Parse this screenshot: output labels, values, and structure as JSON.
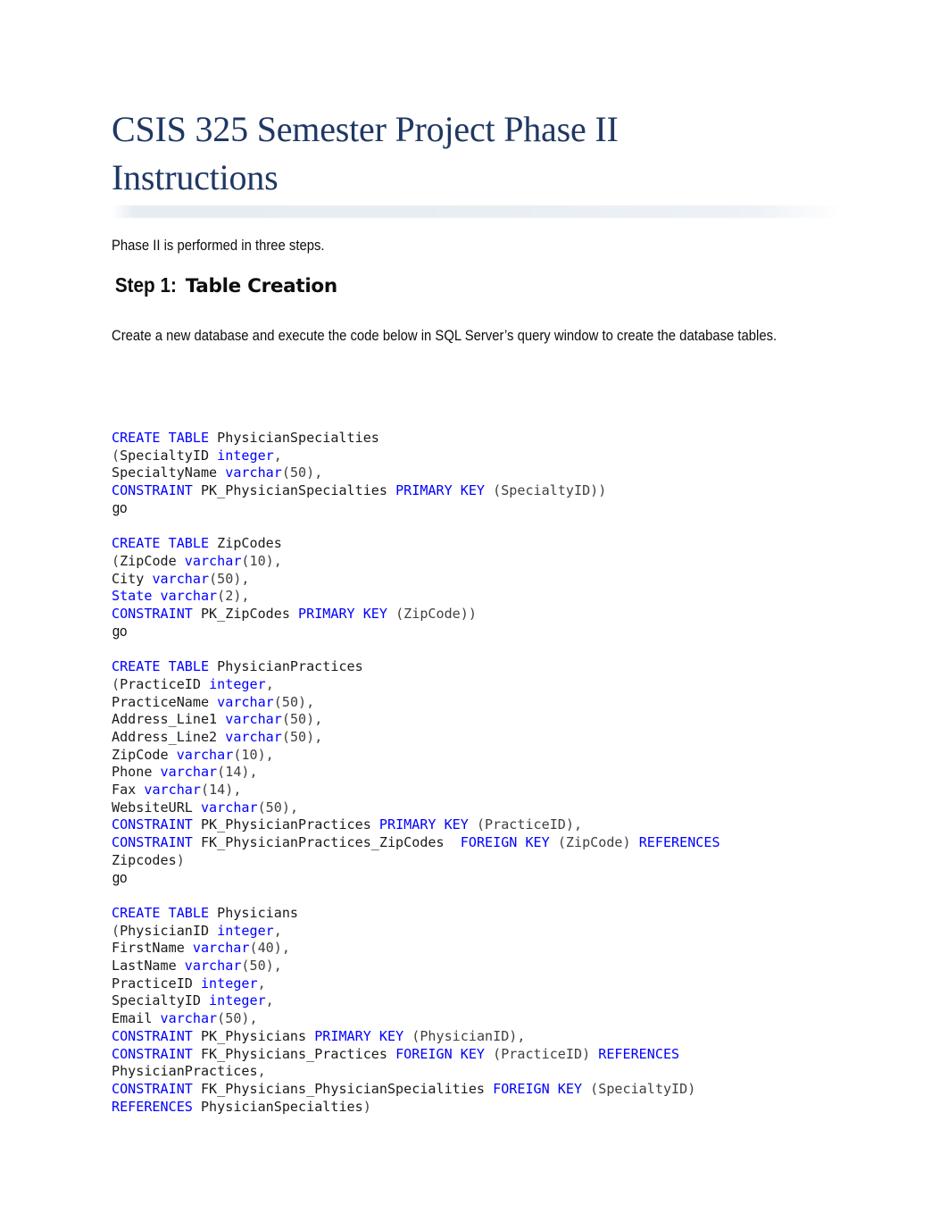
{
  "document": {
    "title": "CSIS 325 Semester Project Phase II Instructions",
    "intro_paragraph": "Phase II is performed in three steps.",
    "step": {
      "label": "Step 1:",
      "title": "Table Creation"
    },
    "step_paragraph": "Create a new database and execute the code below in SQL Server’s query window to create the database tables."
  },
  "colors": {
    "title": "#1F3864",
    "keyword": "#0000FF",
    "identifier": "#1A1A1A",
    "punctuation": "#404040",
    "body_text": "#0D0D0D",
    "rule": "#E9EEF2",
    "page_background": "#FFFFFF"
  },
  "code_blocks": [
    {
      "name": "create-table-physicianspecialties",
      "lines": [
        [
          {
            "t": "CREATE TABLE ",
            "c": "kw"
          },
          {
            "t": "PhysicianSpecialties",
            "c": "id"
          }
        ],
        [
          {
            "t": "(",
            "c": "pun"
          },
          {
            "t": "SpecialtyID ",
            "c": "id"
          },
          {
            "t": "integer",
            "c": "kw"
          },
          {
            "t": ",",
            "c": "pun"
          }
        ],
        [
          {
            "t": "SpecialtyName ",
            "c": "id"
          },
          {
            "t": "varchar",
            "c": "kw"
          },
          {
            "t": "(50),",
            "c": "pun"
          }
        ],
        [
          {
            "t": "CONSTRAINT ",
            "c": "kw"
          },
          {
            "t": "PK_PhysicianSpecialties ",
            "c": "id"
          },
          {
            "t": "PRIMARY KEY ",
            "c": "kw"
          },
          {
            "t": "(SpecialtyID))",
            "c": "pun"
          }
        ],
        [
          {
            "t": "go",
            "c": "go"
          }
        ]
      ]
    },
    {
      "name": "create-table-zipcodes",
      "lines": [
        [
          {
            "t": "CREATE TABLE ",
            "c": "kw"
          },
          {
            "t": "ZipCodes",
            "c": "id"
          }
        ],
        [
          {
            "t": "(",
            "c": "pun"
          },
          {
            "t": "ZipCode ",
            "c": "id"
          },
          {
            "t": "varchar",
            "c": "kw"
          },
          {
            "t": "(10),",
            "c": "pun"
          }
        ],
        [
          {
            "t": "City ",
            "c": "id"
          },
          {
            "t": "varchar",
            "c": "kw"
          },
          {
            "t": "(50),",
            "c": "pun"
          }
        ],
        [
          {
            "t": "State ",
            "c": "kw"
          },
          {
            "t": "varchar",
            "c": "kw"
          },
          {
            "t": "(2),",
            "c": "pun"
          }
        ],
        [
          {
            "t": "CONSTRAINT ",
            "c": "kw"
          },
          {
            "t": "PK_ZipCodes ",
            "c": "id"
          },
          {
            "t": "PRIMARY KEY ",
            "c": "kw"
          },
          {
            "t": "(ZipCode))",
            "c": "pun"
          }
        ],
        [
          {
            "t": "go",
            "c": "go"
          }
        ]
      ]
    },
    {
      "name": "create-table-physicianpractices",
      "lines": [
        [
          {
            "t": "CREATE TABLE ",
            "c": "kw"
          },
          {
            "t": "PhysicianPractices",
            "c": "id"
          }
        ],
        [
          {
            "t": "(",
            "c": "pun"
          },
          {
            "t": "PracticeID ",
            "c": "id"
          },
          {
            "t": "integer",
            "c": "kw"
          },
          {
            "t": ",",
            "c": "pun"
          }
        ],
        [
          {
            "t": "PracticeName ",
            "c": "id"
          },
          {
            "t": "varchar",
            "c": "kw"
          },
          {
            "t": "(50),",
            "c": "pun"
          }
        ],
        [
          {
            "t": "Address_Line1 ",
            "c": "id"
          },
          {
            "t": "varchar",
            "c": "kw"
          },
          {
            "t": "(50),",
            "c": "pun"
          }
        ],
        [
          {
            "t": "Address_Line2 ",
            "c": "id"
          },
          {
            "t": "varchar",
            "c": "kw"
          },
          {
            "t": "(50),",
            "c": "pun"
          }
        ],
        [
          {
            "t": "ZipCode ",
            "c": "id"
          },
          {
            "t": "varchar",
            "c": "kw"
          },
          {
            "t": "(10),",
            "c": "pun"
          }
        ],
        [
          {
            "t": "Phone ",
            "c": "id"
          },
          {
            "t": "varchar",
            "c": "kw"
          },
          {
            "t": "(14),",
            "c": "pun"
          }
        ],
        [
          {
            "t": "Fax ",
            "c": "id"
          },
          {
            "t": "varchar",
            "c": "kw"
          },
          {
            "t": "(14),",
            "c": "pun"
          }
        ],
        [
          {
            "t": "WebsiteURL ",
            "c": "id"
          },
          {
            "t": "varchar",
            "c": "kw"
          },
          {
            "t": "(50),",
            "c": "pun"
          }
        ],
        [
          {
            "t": "CONSTRAINT ",
            "c": "kw"
          },
          {
            "t": "PK_PhysicianPractices ",
            "c": "id"
          },
          {
            "t": "PRIMARY KEY ",
            "c": "kw"
          },
          {
            "t": "(PracticeID),",
            "c": "pun"
          }
        ],
        [
          {
            "t": "CONSTRAINT ",
            "c": "kw"
          },
          {
            "t": "FK_PhysicianPractices_ZipCodes  ",
            "c": "id"
          },
          {
            "t": "FOREIGN KEY ",
            "c": "kw"
          },
          {
            "t": "(ZipCode) ",
            "c": "pun"
          },
          {
            "t": "REFERENCES",
            "c": "kw"
          }
        ],
        [
          {
            "t": "Zipcodes",
            "c": "id"
          },
          {
            "t": ")",
            "c": "pun"
          }
        ],
        [
          {
            "t": "go",
            "c": "go"
          }
        ]
      ]
    },
    {
      "name": "create-table-physicians",
      "lines": [
        [
          {
            "t": "CREATE TABLE ",
            "c": "kw"
          },
          {
            "t": "Physicians",
            "c": "id"
          }
        ],
        [
          {
            "t": "(",
            "c": "pun"
          },
          {
            "t": "PhysicianID ",
            "c": "id"
          },
          {
            "t": "integer",
            "c": "kw"
          },
          {
            "t": ",",
            "c": "pun"
          }
        ],
        [
          {
            "t": "FirstName ",
            "c": "id"
          },
          {
            "t": "varchar",
            "c": "kw"
          },
          {
            "t": "(40),",
            "c": "pun"
          }
        ],
        [
          {
            "t": "LastName ",
            "c": "id"
          },
          {
            "t": "varchar",
            "c": "kw"
          },
          {
            "t": "(50),",
            "c": "pun"
          }
        ],
        [
          {
            "t": "PracticeID ",
            "c": "id"
          },
          {
            "t": "integer",
            "c": "kw"
          },
          {
            "t": ",",
            "c": "pun"
          }
        ],
        [
          {
            "t": "SpecialtyID ",
            "c": "id"
          },
          {
            "t": "integer",
            "c": "kw"
          },
          {
            "t": ",",
            "c": "pun"
          }
        ],
        [
          {
            "t": "Email ",
            "c": "id"
          },
          {
            "t": "varchar",
            "c": "kw"
          },
          {
            "t": "(50),",
            "c": "pun"
          }
        ],
        [
          {
            "t": "CONSTRAINT ",
            "c": "kw"
          },
          {
            "t": "PK_Physicians ",
            "c": "id"
          },
          {
            "t": "PRIMARY KEY ",
            "c": "kw"
          },
          {
            "t": "(PhysicianID),",
            "c": "pun"
          }
        ],
        [
          {
            "t": "CONSTRAINT ",
            "c": "kw"
          },
          {
            "t": "FK_Physicians_Practices ",
            "c": "id"
          },
          {
            "t": "FOREIGN KEY ",
            "c": "kw"
          },
          {
            "t": "(PracticeID) ",
            "c": "pun"
          },
          {
            "t": "REFERENCES",
            "c": "kw"
          }
        ],
        [
          {
            "t": "PhysicianPractices",
            "c": "id"
          },
          {
            "t": ",",
            "c": "pun"
          }
        ],
        [
          {
            "t": "CONSTRAINT ",
            "c": "kw"
          },
          {
            "t": "FK_Physicians_PhysicianSpecialities ",
            "c": "id"
          },
          {
            "t": "FOREIGN KEY ",
            "c": "kw"
          },
          {
            "t": "(SpecialtyID)",
            "c": "pun"
          }
        ],
        [
          {
            "t": "REFERENCES ",
            "c": "kw"
          },
          {
            "t": "PhysicianSpecialties",
            "c": "id"
          },
          {
            "t": ")",
            "c": "pun"
          }
        ]
      ]
    }
  ]
}
